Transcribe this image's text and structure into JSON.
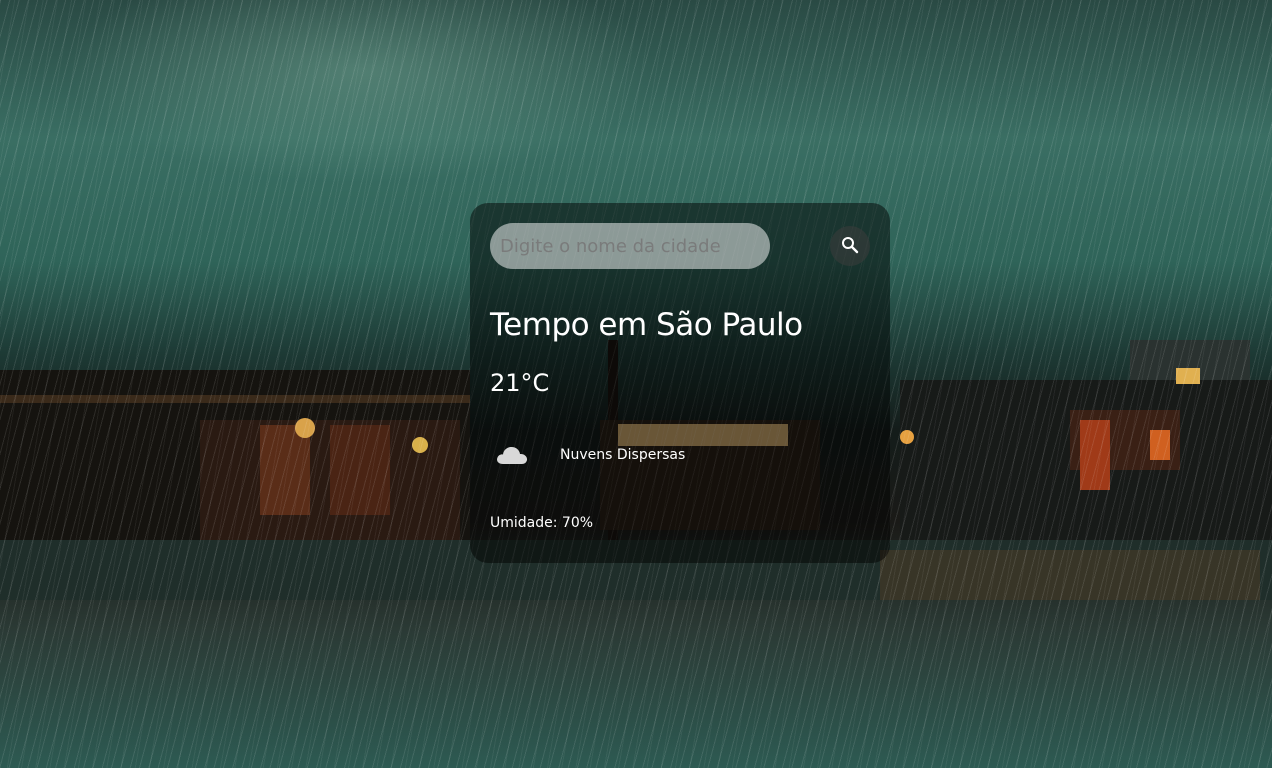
{
  "search": {
    "placeholder": "Digite o nome da cidade",
    "value": "",
    "button_icon": "search-icon"
  },
  "weather": {
    "title": "Tempo em São Paulo",
    "temperature": "21°C",
    "icon": "cloud-icon",
    "description": "Nuvens Dispersas",
    "humidity": "Umidade: 70%"
  },
  "colors": {
    "card_background": "rgba(0,0,0,0.48)",
    "text": "#ffffff",
    "input_background": "rgba(255,255,255,0.50)"
  }
}
